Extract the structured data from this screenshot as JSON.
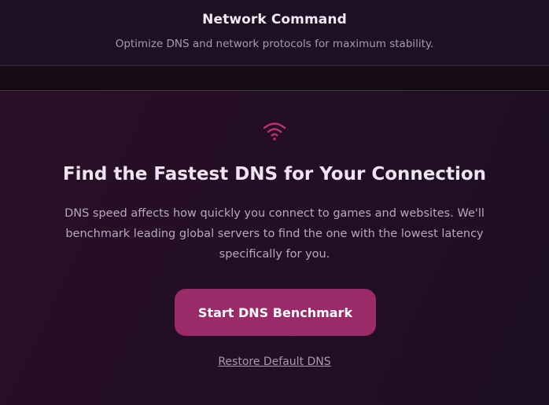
{
  "header": {
    "title": "Network Command",
    "subtitle": "Optimize DNS and network protocols for maximum stability."
  },
  "card": {
    "icon": "wifi-icon",
    "headline": "Find the Fastest DNS for Your Connection",
    "description": "DNS speed affects how quickly you connect to games and websites. We'll benchmark leading global servers to find the one with the lowest latency specifically for you.",
    "start_button_label": "Start DNS Benchmark",
    "restore_link_label": "Restore Default DNS"
  },
  "colors": {
    "accent": "#9a2a68",
    "icon": "#c0306f",
    "background": "#1a0d1f"
  }
}
